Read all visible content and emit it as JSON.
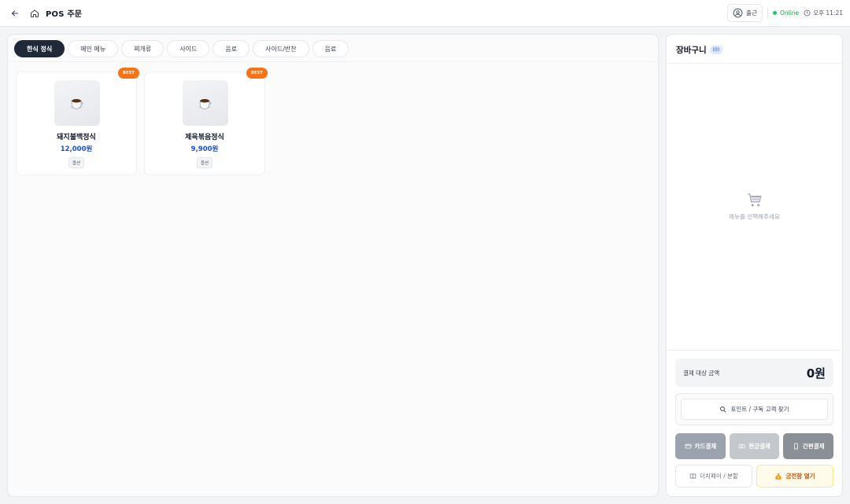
{
  "header": {
    "title": "POS 주문",
    "clock_out_label": "출근",
    "status_label": "Online",
    "time": "오후 11:21"
  },
  "tabs": [
    {
      "label": "한식 정식",
      "active": true
    },
    {
      "label": "메인 메뉴",
      "active": false
    },
    {
      "label": "찌개류",
      "active": false
    },
    {
      "label": "사이드",
      "active": false
    },
    {
      "label": "음료",
      "active": false
    },
    {
      "label": "사이드/반찬",
      "active": false
    },
    {
      "label": "음료",
      "active": false
    }
  ],
  "products": [
    {
      "badge": "BEST",
      "name": "돼지불백정식",
      "price": "12,000원",
      "option": "옵션",
      "icon": "coffee-cup-icon"
    },
    {
      "badge": "BEST",
      "name": "제육볶음정식",
      "price": "9,900원",
      "option": "옵션",
      "icon": "coffee-cup-icon"
    }
  ],
  "cart": {
    "title": "장바구니",
    "count": "(0)",
    "empty_text": "메뉴를 선택해주세요",
    "total_label": "결제 대상 금액",
    "total_amount": "0원",
    "search_label": "포인트 / 구독 고객 찾기",
    "pay_card": "카드결제",
    "pay_cash": "현금결제",
    "pay_easy": "간편결제",
    "split_label": "더치페이 / 분할",
    "drawer_label": "금전함 열기"
  },
  "colors": {
    "accent": "#1f2937",
    "price": "#1d4ed8",
    "best_badge": "#f97316",
    "online": "#22c55e"
  }
}
